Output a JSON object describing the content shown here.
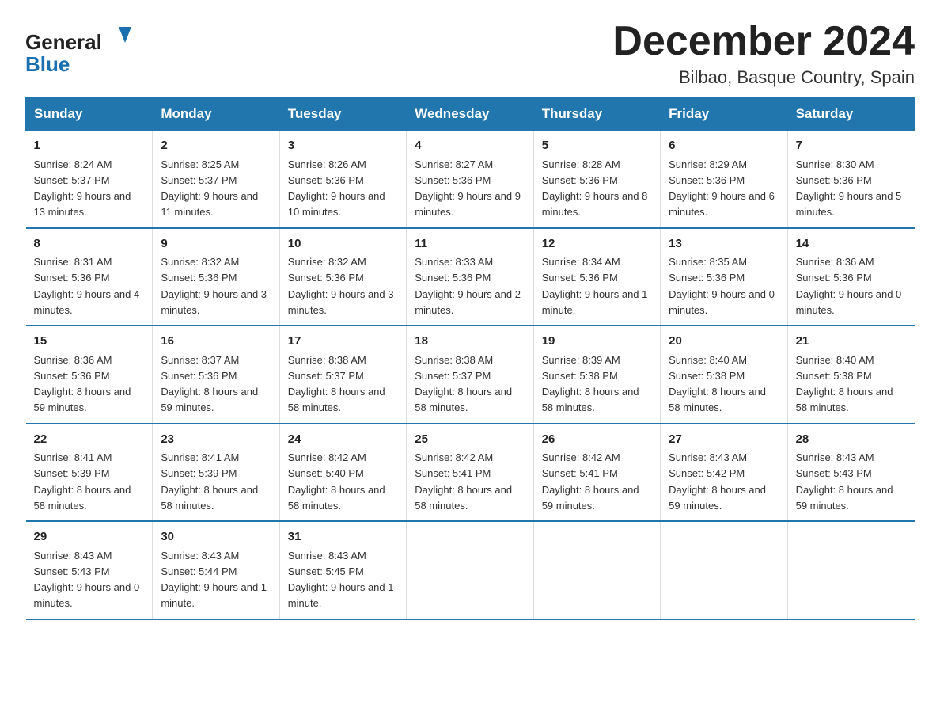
{
  "logo": {
    "general": "General",
    "blue": "Blue",
    "triangle_color": "#1a6faf"
  },
  "header": {
    "title": "December 2024",
    "subtitle": "Bilbao, Basque Country, Spain"
  },
  "weekdays": [
    "Sunday",
    "Monday",
    "Tuesday",
    "Wednesday",
    "Thursday",
    "Friday",
    "Saturday"
  ],
  "weeks": [
    [
      {
        "day": "1",
        "sunrise": "Sunrise: 8:24 AM",
        "sunset": "Sunset: 5:37 PM",
        "daylight": "Daylight: 9 hours and 13 minutes."
      },
      {
        "day": "2",
        "sunrise": "Sunrise: 8:25 AM",
        "sunset": "Sunset: 5:37 PM",
        "daylight": "Daylight: 9 hours and 11 minutes."
      },
      {
        "day": "3",
        "sunrise": "Sunrise: 8:26 AM",
        "sunset": "Sunset: 5:36 PM",
        "daylight": "Daylight: 9 hours and 10 minutes."
      },
      {
        "day": "4",
        "sunrise": "Sunrise: 8:27 AM",
        "sunset": "Sunset: 5:36 PM",
        "daylight": "Daylight: 9 hours and 9 minutes."
      },
      {
        "day": "5",
        "sunrise": "Sunrise: 8:28 AM",
        "sunset": "Sunset: 5:36 PM",
        "daylight": "Daylight: 9 hours and 8 minutes."
      },
      {
        "day": "6",
        "sunrise": "Sunrise: 8:29 AM",
        "sunset": "Sunset: 5:36 PM",
        "daylight": "Daylight: 9 hours and 6 minutes."
      },
      {
        "day": "7",
        "sunrise": "Sunrise: 8:30 AM",
        "sunset": "Sunset: 5:36 PM",
        "daylight": "Daylight: 9 hours and 5 minutes."
      }
    ],
    [
      {
        "day": "8",
        "sunrise": "Sunrise: 8:31 AM",
        "sunset": "Sunset: 5:36 PM",
        "daylight": "Daylight: 9 hours and 4 minutes."
      },
      {
        "day": "9",
        "sunrise": "Sunrise: 8:32 AM",
        "sunset": "Sunset: 5:36 PM",
        "daylight": "Daylight: 9 hours and 3 minutes."
      },
      {
        "day": "10",
        "sunrise": "Sunrise: 8:32 AM",
        "sunset": "Sunset: 5:36 PM",
        "daylight": "Daylight: 9 hours and 3 minutes."
      },
      {
        "day": "11",
        "sunrise": "Sunrise: 8:33 AM",
        "sunset": "Sunset: 5:36 PM",
        "daylight": "Daylight: 9 hours and 2 minutes."
      },
      {
        "day": "12",
        "sunrise": "Sunrise: 8:34 AM",
        "sunset": "Sunset: 5:36 PM",
        "daylight": "Daylight: 9 hours and 1 minute."
      },
      {
        "day": "13",
        "sunrise": "Sunrise: 8:35 AM",
        "sunset": "Sunset: 5:36 PM",
        "daylight": "Daylight: 9 hours and 0 minutes."
      },
      {
        "day": "14",
        "sunrise": "Sunrise: 8:36 AM",
        "sunset": "Sunset: 5:36 PM",
        "daylight": "Daylight: 9 hours and 0 minutes."
      }
    ],
    [
      {
        "day": "15",
        "sunrise": "Sunrise: 8:36 AM",
        "sunset": "Sunset: 5:36 PM",
        "daylight": "Daylight: 8 hours and 59 minutes."
      },
      {
        "day": "16",
        "sunrise": "Sunrise: 8:37 AM",
        "sunset": "Sunset: 5:36 PM",
        "daylight": "Daylight: 8 hours and 59 minutes."
      },
      {
        "day": "17",
        "sunrise": "Sunrise: 8:38 AM",
        "sunset": "Sunset: 5:37 PM",
        "daylight": "Daylight: 8 hours and 58 minutes."
      },
      {
        "day": "18",
        "sunrise": "Sunrise: 8:38 AM",
        "sunset": "Sunset: 5:37 PM",
        "daylight": "Daylight: 8 hours and 58 minutes."
      },
      {
        "day": "19",
        "sunrise": "Sunrise: 8:39 AM",
        "sunset": "Sunset: 5:38 PM",
        "daylight": "Daylight: 8 hours and 58 minutes."
      },
      {
        "day": "20",
        "sunrise": "Sunrise: 8:40 AM",
        "sunset": "Sunset: 5:38 PM",
        "daylight": "Daylight: 8 hours and 58 minutes."
      },
      {
        "day": "21",
        "sunrise": "Sunrise: 8:40 AM",
        "sunset": "Sunset: 5:38 PM",
        "daylight": "Daylight: 8 hours and 58 minutes."
      }
    ],
    [
      {
        "day": "22",
        "sunrise": "Sunrise: 8:41 AM",
        "sunset": "Sunset: 5:39 PM",
        "daylight": "Daylight: 8 hours and 58 minutes."
      },
      {
        "day": "23",
        "sunrise": "Sunrise: 8:41 AM",
        "sunset": "Sunset: 5:39 PM",
        "daylight": "Daylight: 8 hours and 58 minutes."
      },
      {
        "day": "24",
        "sunrise": "Sunrise: 8:42 AM",
        "sunset": "Sunset: 5:40 PM",
        "daylight": "Daylight: 8 hours and 58 minutes."
      },
      {
        "day": "25",
        "sunrise": "Sunrise: 8:42 AM",
        "sunset": "Sunset: 5:41 PM",
        "daylight": "Daylight: 8 hours and 58 minutes."
      },
      {
        "day": "26",
        "sunrise": "Sunrise: 8:42 AM",
        "sunset": "Sunset: 5:41 PM",
        "daylight": "Daylight: 8 hours and 59 minutes."
      },
      {
        "day": "27",
        "sunrise": "Sunrise: 8:43 AM",
        "sunset": "Sunset: 5:42 PM",
        "daylight": "Daylight: 8 hours and 59 minutes."
      },
      {
        "day": "28",
        "sunrise": "Sunrise: 8:43 AM",
        "sunset": "Sunset: 5:43 PM",
        "daylight": "Daylight: 8 hours and 59 minutes."
      }
    ],
    [
      {
        "day": "29",
        "sunrise": "Sunrise: 8:43 AM",
        "sunset": "Sunset: 5:43 PM",
        "daylight": "Daylight: 9 hours and 0 minutes."
      },
      {
        "day": "30",
        "sunrise": "Sunrise: 8:43 AM",
        "sunset": "Sunset: 5:44 PM",
        "daylight": "Daylight: 9 hours and 1 minute."
      },
      {
        "day": "31",
        "sunrise": "Sunrise: 8:43 AM",
        "sunset": "Sunset: 5:45 PM",
        "daylight": "Daylight: 9 hours and 1 minute."
      },
      null,
      null,
      null,
      null
    ]
  ]
}
